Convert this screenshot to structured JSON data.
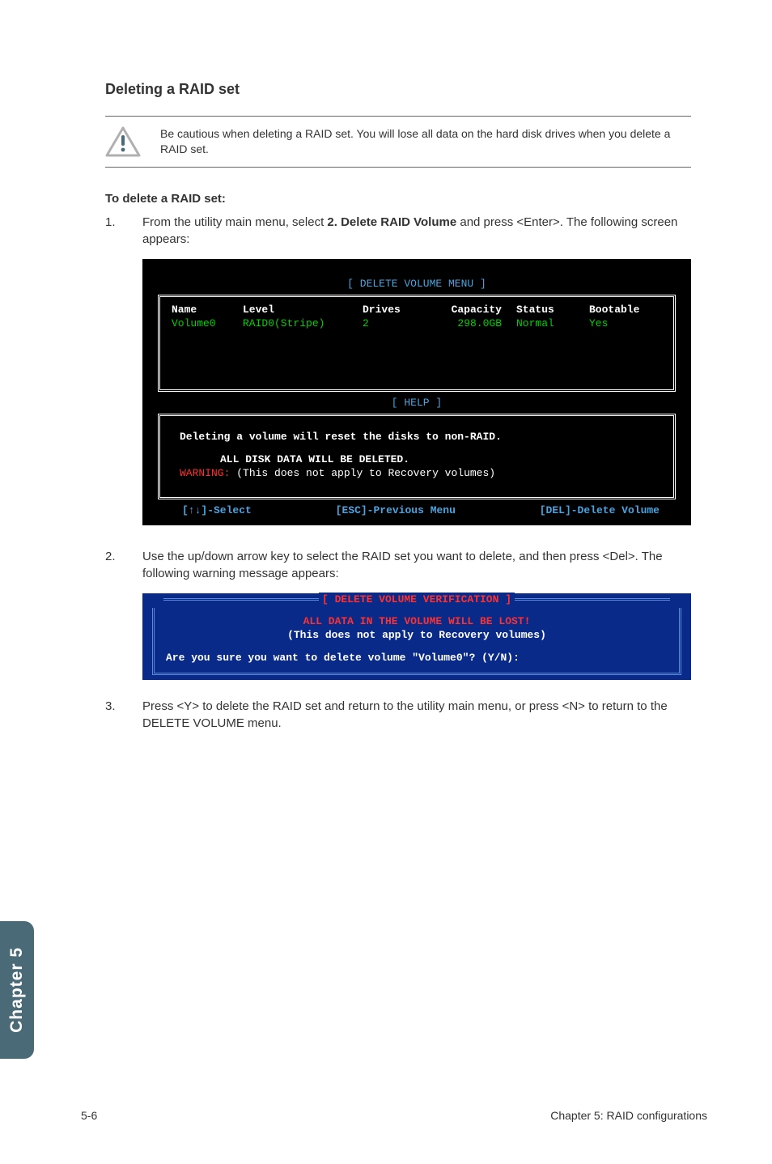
{
  "heading": "Deleting a RAID set",
  "warning": "Be cautious when deleting a RAID set. You will lose all data on the hard disk drives when you delete a RAID set.",
  "subheading": "To delete a RAID set:",
  "steps": {
    "s1": {
      "num": "1.",
      "pre": "From the utility main menu, select ",
      "bold": "2. Delete RAID Volume",
      "post": " and press <Enter>. The following screen appears:"
    },
    "s2": {
      "num": "2.",
      "text": "Use the up/down arrow key to select the RAID set you want to delete, and then press <Del>. The following warning message appears:"
    },
    "s3": {
      "num": "3.",
      "text": "Press <Y> to delete the RAID set and return to the utility main menu, or press <N> to return to the DELETE VOLUME menu."
    }
  },
  "terminal": {
    "title": "[ DELETE VOLUME MENU ]",
    "columns": {
      "name": "Name",
      "level": "Level",
      "drives": "Drives",
      "capacity": "Capacity",
      "status": "Status",
      "bootable": "Bootable"
    },
    "row": {
      "name": "Volume0",
      "level": "RAID0(Stripe)",
      "drives": "2",
      "capacity": "298.0GB",
      "status": "Normal",
      "bootable": "Yes"
    },
    "help_title": "[ HELP ]",
    "help1": "Deleting a volume will reset the disks to non-RAID.",
    "help2": "ALL DISK DATA WILL BE DELETED.",
    "warn_label": "WARNING:",
    "help3": " (This does not apply to Recovery volumes)",
    "foot_select": "[↑↓]-Select",
    "foot_prev": "[ESC]-Previous Menu",
    "foot_del": "[DEL]-Delete Volume"
  },
  "verify": {
    "title": "[ DELETE VOLUME VERIFICATION ]",
    "line_red": "ALL DATA IN THE VOLUME WILL BE LOST!",
    "line_white": "(This does not apply to Recovery volumes)",
    "question": "Are you sure you want to delete volume \"Volume0\"? (Y/N):"
  },
  "side_tab": "Chapter 5",
  "footer": {
    "left": "5-6",
    "right": "Chapter 5: RAID configurations"
  }
}
